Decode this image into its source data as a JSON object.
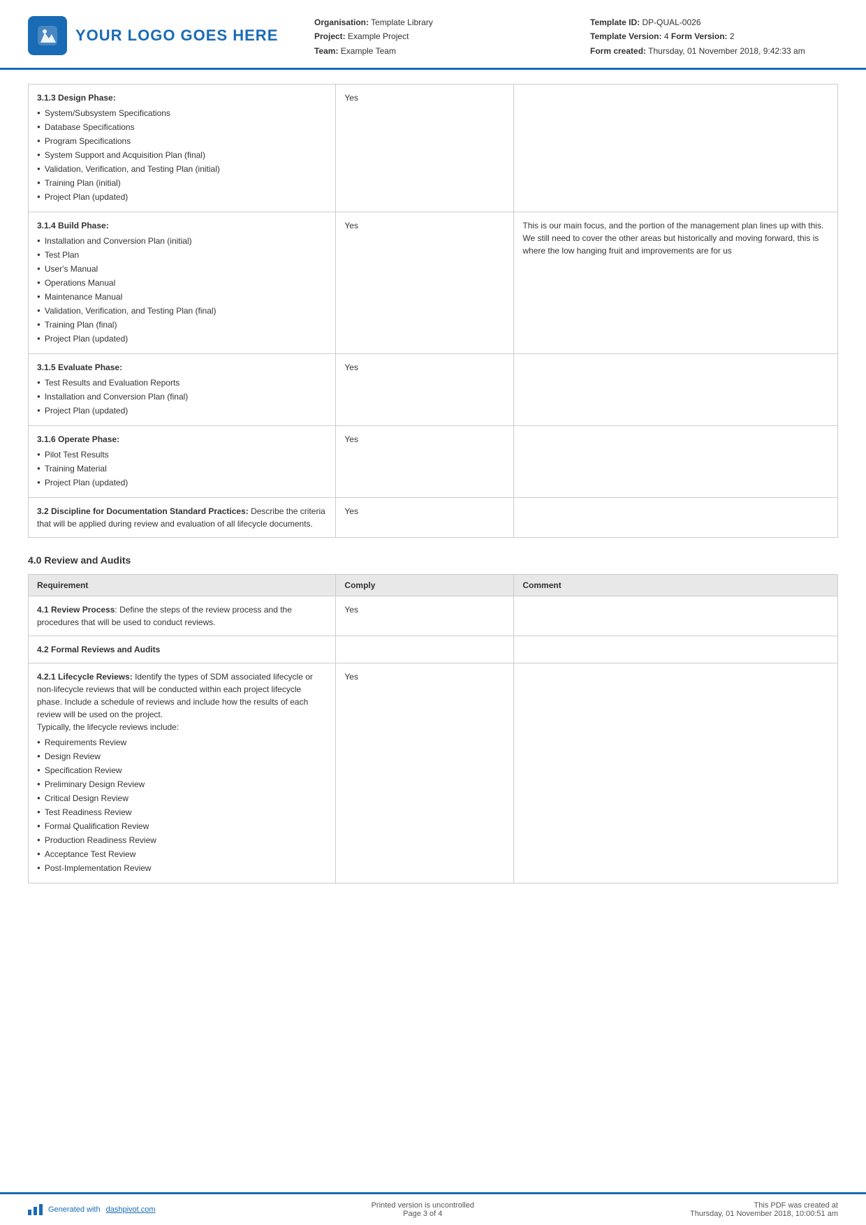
{
  "header": {
    "logo_text": "YOUR LOGO GOES HERE",
    "org_label": "Organisation:",
    "org_value": "Template Library",
    "project_label": "Project:",
    "project_value": "Example Project",
    "team_label": "Team:",
    "team_value": "Example Team",
    "template_id_label": "Template ID:",
    "template_id_value": "DP-QUAL-0026",
    "template_version_label": "Template Version:",
    "template_version_value": "4",
    "form_version_label": "Form Version:",
    "form_version_value": "2",
    "form_created_label": "Form created:",
    "form_created_value": "Thursday, 01 November 2018, 9:42:33 am"
  },
  "main_table": {
    "rows": [
      {
        "requirement": {
          "title": "3.1.3 Design Phase:",
          "bullets": [
            "System/Subsystem Specifications",
            "Database Specifications",
            "Program Specifications",
            "System Support and Acquisition Plan (final)",
            "Validation, Verification, and Testing Plan (initial)",
            "Training Plan (initial)",
            "Project Plan (updated)"
          ]
        },
        "comply": "Yes",
        "comment": ""
      },
      {
        "requirement": {
          "title": "3.1.4 Build Phase:",
          "bullets": [
            "Installation and Conversion Plan (initial)",
            "Test Plan",
            "User's Manual",
            "Operations Manual",
            "Maintenance Manual",
            "Validation, Verification, and Testing Plan (final)",
            "Training Plan (final)",
            "Project Plan (updated)"
          ]
        },
        "comply": "Yes",
        "comment": "This is our main focus, and the portion of the management plan lines up with this. We still need to cover the other areas but historically and moving forward, this is where the low hanging fruit and improvements are for us"
      },
      {
        "requirement": {
          "title": "3.1.5 Evaluate Phase:",
          "bullets": [
            "Test Results and Evaluation Reports",
            "Installation and Conversion Plan (final)",
            "Project Plan (updated)"
          ]
        },
        "comply": "Yes",
        "comment": ""
      },
      {
        "requirement": {
          "title": "3.1.6 Operate Phase:",
          "bullets": [
            "Pilot Test Results",
            "Training Material",
            "Project Plan (updated)"
          ]
        },
        "comply": "Yes",
        "comment": ""
      },
      {
        "requirement": {
          "title": "3.2 Discipline for Documentation Standard Practices:",
          "description": "Describe the criteria that will be applied during review and evaluation of all lifecycle documents.",
          "bullets": []
        },
        "comply": "Yes",
        "comment": ""
      }
    ]
  },
  "review_section": {
    "title": "4.0 Review and Audits",
    "table_headers": [
      "Requirement",
      "Comply",
      "Comment"
    ],
    "rows": [
      {
        "requirement": {
          "title": "4.1 Review Process",
          "description": ": Define the steps of the review process and the procedures that will be used to conduct reviews.",
          "bullets": []
        },
        "comply": "Yes",
        "comment": ""
      },
      {
        "requirement": {
          "title": "4.2 Formal Reviews and Audits",
          "description": "",
          "bullets": []
        },
        "comply": "",
        "comment": ""
      },
      {
        "requirement": {
          "title": "4.2.1 Lifecycle Reviews:",
          "description": " Identify the types of SDM associated lifecycle or non-lifecycle reviews that will be conducted within each project lifecycle phase. Include a schedule of reviews and include how the results of each review will be used on the project.\nTypically, the lifecycle reviews include:",
          "bullets": [
            "Requirements Review",
            "Design Review",
            "Specification Review",
            "Preliminary Design Review",
            "Critical Design Review",
            "Test Readiness Review",
            "Formal Qualification Review",
            "Production Readiness Review",
            "Acceptance Test Review",
            "Post-Implementation Review"
          ]
        },
        "comply": "Yes",
        "comment": ""
      }
    ]
  },
  "footer": {
    "generated_text": "Generated with ",
    "link_text": "dashpivot.com",
    "center_text": "Printed version is uncontrolled\nPage 3 of 4",
    "right_text": "This PDF was created at\nThursday, 01 November 2018, 10:00:51 am"
  }
}
